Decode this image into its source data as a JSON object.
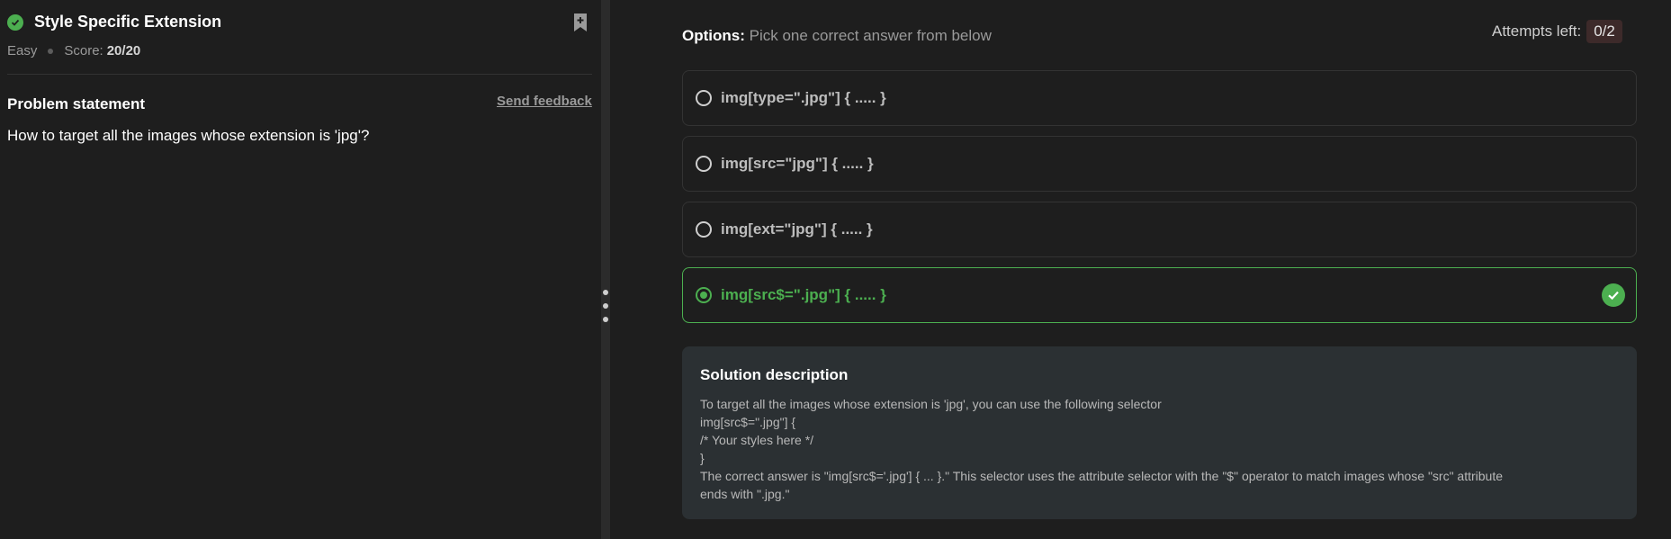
{
  "problem": {
    "title": "Style Specific Extension",
    "difficulty": "Easy",
    "score_label": "Score:",
    "score_value": "20/20",
    "statement_heading": "Problem statement",
    "feedback_link": "Send feedback",
    "question": "How to target all the images whose extension is 'jpg'?"
  },
  "options": {
    "label_bold": "Options:",
    "label_rest": " Pick one correct answer from below",
    "attempts_label": "Attempts left:",
    "attempts_value": "0/2",
    "items": [
      {
        "text": "img[type=\".jpg\"] { ..... }"
      },
      {
        "text": "img[src=\"jpg\"] { ..... }"
      },
      {
        "text": "img[ext=\"jpg\"] { ..... }"
      },
      {
        "text": "img[src$=\".jpg\"] { ..... }"
      }
    ]
  },
  "solution": {
    "heading": "Solution description",
    "lines": [
      "To target all the images whose extension is 'jpg', you can use the following selector",
      "img[src$=\".jpg\"] {",
      "/* Your styles here */",
      "}",
      "The correct answer is \"img[src$='.jpg'] { ... }.\" This selector uses the attribute selector with the \"$\" operator to match images whose \"src\" attribute",
      "ends with \".jpg.\""
    ]
  },
  "colors": {
    "success": "#4caf50",
    "background": "#1e1e1e",
    "solution_bg": "#2b3033"
  }
}
